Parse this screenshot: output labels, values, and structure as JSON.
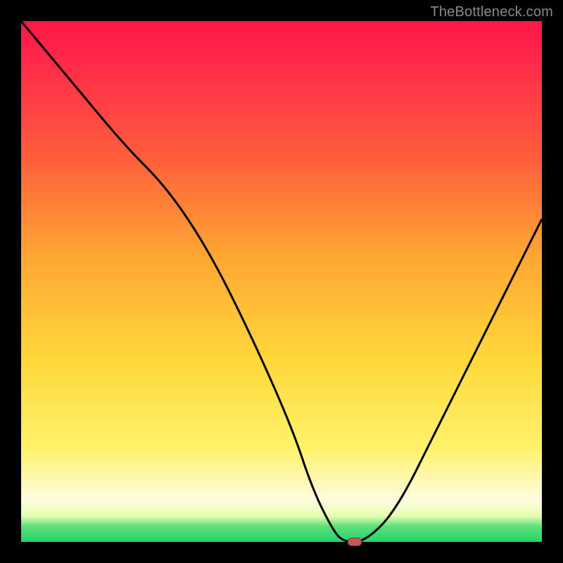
{
  "watermark": "TheBottleneck.com",
  "colors": {
    "gradient_top": "#ff1744",
    "gradient_mid1": "#ffa632",
    "gradient_mid2": "#ffd83a",
    "gradient_bottom": "#20d56a",
    "curve": "#000000",
    "marker_fill": "#c25a5a",
    "marker_border": "#7d3a3a",
    "frame": "#000000"
  },
  "chart_data": {
    "type": "line",
    "title": "",
    "xlabel": "",
    "ylabel": "",
    "xlim": [
      0,
      100
    ],
    "ylim": [
      0,
      100
    ],
    "x": [
      0,
      10,
      20,
      28,
      36,
      44,
      52,
      56,
      60,
      62,
      66,
      72,
      80,
      90,
      100
    ],
    "values": [
      100,
      88,
      76,
      68,
      56,
      40,
      22,
      10,
      2,
      0,
      0,
      6,
      22,
      42,
      62
    ],
    "marker": {
      "x": 64,
      "y": 0
    },
    "grid": false,
    "legend": false
  }
}
